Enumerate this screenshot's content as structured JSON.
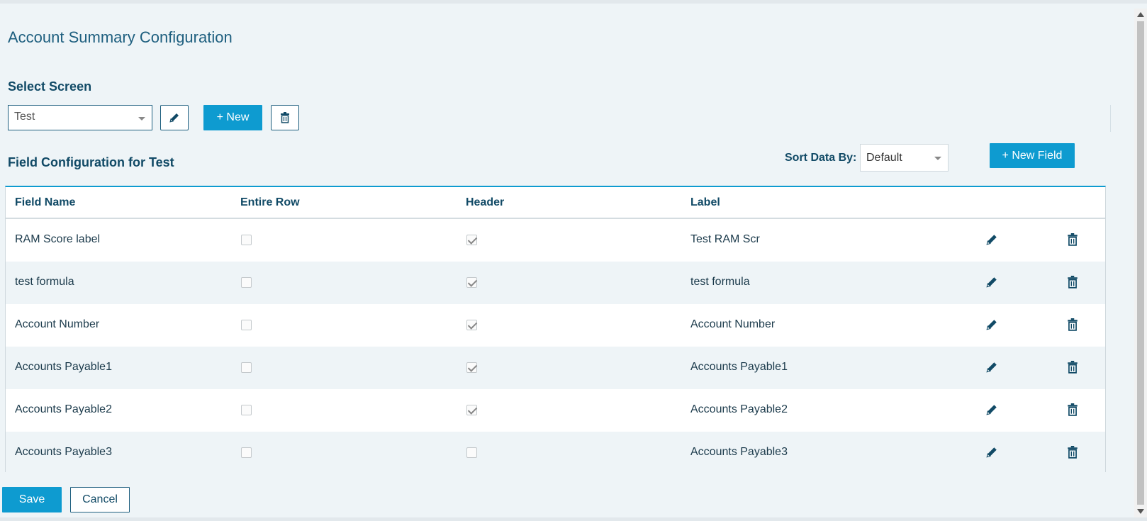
{
  "page": {
    "title": "Account Summary Configuration"
  },
  "screen_select": {
    "label": "Select Screen",
    "value": "Test",
    "new_button": "+ New"
  },
  "field_config": {
    "title": "Field Configuration for Test",
    "sort_label": "Sort Data By:",
    "sort_value": "Default",
    "new_field_button": "+ New Field"
  },
  "table": {
    "headers": [
      "Field Name",
      "Entire Row",
      "Header",
      "Label"
    ],
    "rows": [
      {
        "field_name": "RAM Score label",
        "entire_row": false,
        "header": true,
        "label": "Test RAM Scr"
      },
      {
        "field_name": "test formula",
        "entire_row": false,
        "header": true,
        "label": "test formula"
      },
      {
        "field_name": "Account Number",
        "entire_row": false,
        "header": true,
        "label": "Account Number"
      },
      {
        "field_name": "Accounts Payable1",
        "entire_row": false,
        "header": true,
        "label": "Accounts Payable1"
      },
      {
        "field_name": "Accounts Payable2",
        "entire_row": false,
        "header": true,
        "label": "Accounts Payable2"
      },
      {
        "field_name": "Accounts Payable3",
        "entire_row": false,
        "header": false,
        "label": "Accounts Payable3"
      }
    ]
  },
  "footer": {
    "save_label": "Save",
    "cancel_label": "Cancel"
  },
  "icons": {
    "edit": "pencil-icon",
    "delete": "trash-icon"
  },
  "colors": {
    "accent": "#0e9bd0",
    "title": "#1e5f7f",
    "heading": "#114a66",
    "background": "#eef4f7"
  }
}
